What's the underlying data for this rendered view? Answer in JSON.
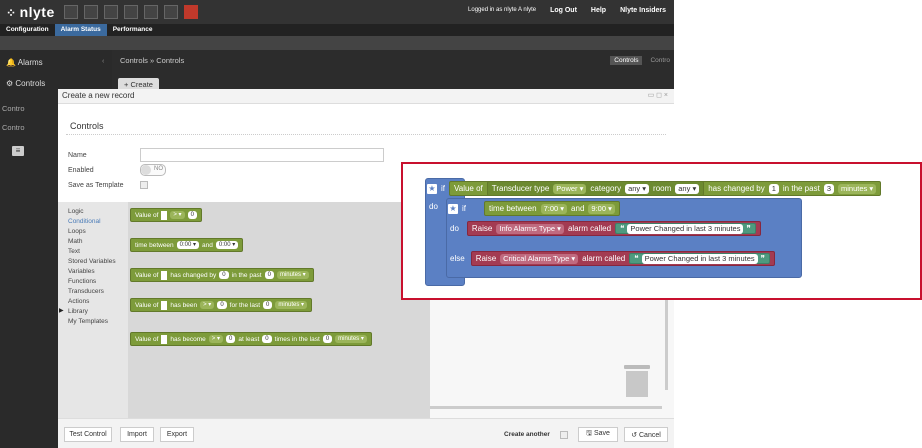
{
  "app": {
    "logo": "nlyte"
  },
  "header": {
    "logged_in": "Logged in as nlyte A nlyte",
    "logout": "Log Out",
    "help": "Help",
    "insiders": "Nlyte Insiders"
  },
  "nav": {
    "tabs": [
      "Configuration",
      "Alarm Status",
      "Performance"
    ]
  },
  "sidebar": {
    "alarms": "Alarms",
    "controls": "Controls",
    "sub1": "Contro",
    "sub2": "Contro"
  },
  "breadcrumb": "Controls  »  Controls",
  "crumb_tabs": [
    "Controls",
    "Contro"
  ],
  "create_button": "+ Create",
  "modal": {
    "title": "Create a new record",
    "controls": "▭ ◻ ×",
    "section": "Controls",
    "fields": {
      "name_label": "Name",
      "enabled_label": "Enabled",
      "enabled_value": "NO",
      "template_label": "Save as Template"
    }
  },
  "toolbox": {
    "categories": [
      "Logic",
      "Conditional",
      "Loops",
      "Math",
      "Text",
      "Stored Variables",
      "Variables",
      "Functions",
      "Transducers",
      "Actions",
      "Library",
      "My Templates"
    ]
  },
  "flyout": {
    "b1": {
      "value_of": "Value of",
      "op": "> ▾",
      "num": "0"
    },
    "b2": {
      "time_between": "time between",
      "t1": "0:00 ▾",
      "and": "and",
      "t2": "0:00 ▾"
    },
    "b3": {
      "value_of": "Value of",
      "changed": "has changed by",
      "num": "0",
      "in_past": "in the past",
      "num2": "0",
      "unit": "minutes ▾"
    },
    "b4": {
      "value_of": "Value of",
      "been": "has been",
      "op": "> ▾",
      "num": "0",
      "last": "for the last",
      "num2": "0",
      "unit": "minutes ▾"
    },
    "b5": {
      "value_of": "Value of",
      "become": "has become",
      "op": "> ▾",
      "num": "0",
      "at_least": "at least",
      "num2": "0",
      "times": "times in the last",
      "num3": "0",
      "unit": "minutes ▾"
    }
  },
  "footer": {
    "test": "Test Control",
    "import": "Import",
    "export": "Export",
    "create_another": "Create another",
    "save": "🖫 Save",
    "cancel": "↺ Cancel"
  },
  "zoom": {
    "if": "if",
    "value_of": "Value of",
    "transducer_type": "Transducer type",
    "power": "Power ▾",
    "category": "category",
    "any1": "any ▾",
    "room": "room",
    "any2": "any ▾",
    "changed": "has changed by",
    "num1": "1",
    "in_past": "in the past",
    "num2": "3",
    "minutes": "minutes ▾",
    "do": "do",
    "inner_if": "if",
    "time_between": "time between",
    "t1": "7:00 ▾",
    "and": "and",
    "t2": "9:00 ▾",
    "inner_do": "do",
    "raise1": "Raise",
    "alarm_type1": "Info Alarms Type ▾",
    "alarm_called1": "alarm called",
    "msg1": "Power Changed in last 3 minutes",
    "else": "else",
    "raise2": "Raise",
    "alarm_type2": "Critical Alarms Type ▾",
    "alarm_called2": "alarm called",
    "msg2": "Power Changed in last 3 minutes",
    "quote_open": "❝",
    "quote_close": "❞"
  },
  "colors": {
    "logic_block": "#5b80c4",
    "value_block": "#7d9b3a",
    "action_block": "#a33b52",
    "text_block": "#4e9a7f",
    "highlight_border": "#c8102e",
    "active_tab": "#3b6a9e"
  }
}
